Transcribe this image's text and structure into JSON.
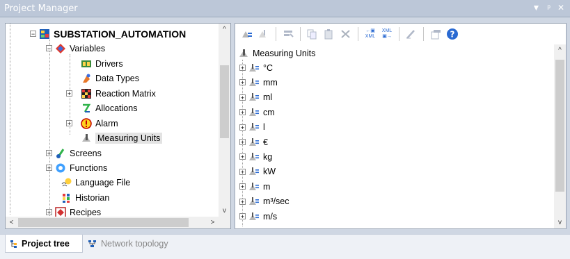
{
  "window": {
    "title": "Project Manager",
    "controls": [
      "▼",
      "ᵖ",
      "✕"
    ]
  },
  "tree": {
    "root": "SUBSTATION_AUTOMATION",
    "variables": "Variables",
    "drivers": "Drivers",
    "data_types": "Data Types",
    "reaction_matrix": "Reaction Matrix",
    "allocations": "Allocations",
    "alarm": "Alarm",
    "measuring_units": "Measuring Units",
    "screens": "Screens",
    "functions": "Functions",
    "language_file": "Language File",
    "historian": "Historian",
    "recipes": "Recipes"
  },
  "units_list": {
    "header": "Measuring Units",
    "items": [
      "°C",
      "mm",
      "ml",
      "cm",
      "l",
      "€",
      "kg",
      "kW",
      "m",
      "m³/sec",
      "m/s"
    ]
  },
  "toolbar": {
    "xml_label_1": "XML",
    "xml_label_2": "XML"
  },
  "tabs": {
    "project_tree": "Project tree",
    "network_topology": "Network topology"
  },
  "colors": {
    "title_bar": "#bcc7d8",
    "frame": "#cfd7e3",
    "selection": "#e3e3e3"
  }
}
